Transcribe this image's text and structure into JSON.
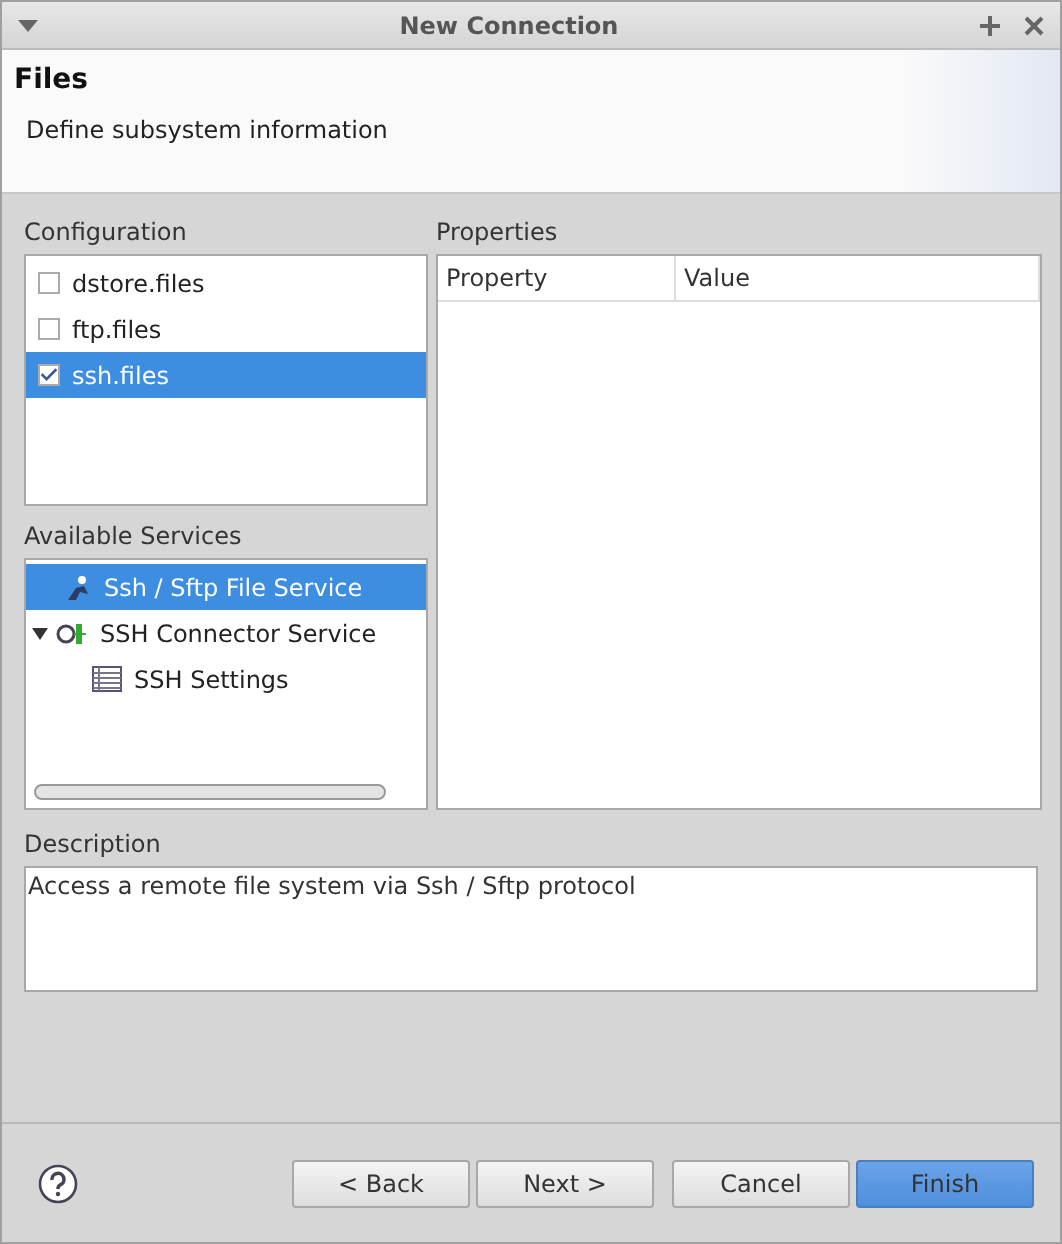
{
  "window": {
    "title": "New Connection"
  },
  "header": {
    "title": "Files",
    "subtitle": "Define subsystem information"
  },
  "configuration": {
    "label": "Configuration",
    "items": [
      {
        "label": "dstore.files",
        "checked": false,
        "selected": false
      },
      {
        "label": "ftp.files",
        "checked": false,
        "selected": false
      },
      {
        "label": "ssh.files",
        "checked": true,
        "selected": true
      }
    ]
  },
  "available_services": {
    "label": "Available Services",
    "items": [
      {
        "label": "Ssh / Sftp File Service",
        "kind": "service",
        "selected": true
      },
      {
        "label": "SSH Connector Service",
        "kind": "connector",
        "selected": false,
        "expanded": true,
        "children": [
          {
            "label": "SSH Settings",
            "kind": "settings",
            "selected": false
          }
        ]
      }
    ]
  },
  "properties": {
    "label": "Properties",
    "columns": [
      "Property",
      "Value"
    ]
  },
  "description": {
    "label": "Description",
    "text": "Access a remote file system via Ssh / Sftp protocol"
  },
  "buttons": [
    {
      "label": "< Back",
      "primary": false
    },
    {
      "label": "Next >",
      "primary": false
    },
    {
      "label": "Cancel",
      "primary": false
    },
    {
      "label": "Finish",
      "primary": true
    }
  ]
}
